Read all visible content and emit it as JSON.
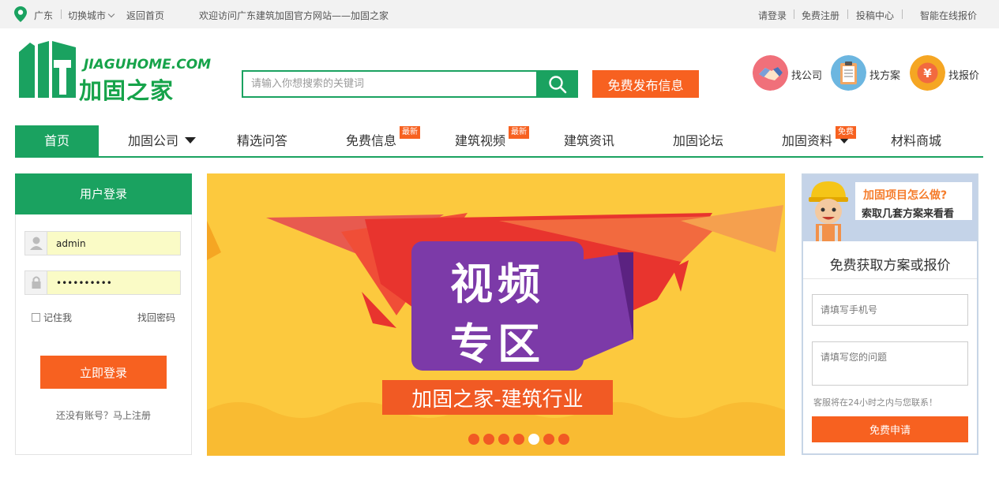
{
  "topbar": {
    "location": "广东",
    "switch_city": "切换城市",
    "back_home": "返回首页",
    "welcome": "欢迎访问广东建筑加固官方网站——加固之家",
    "login": "请登录",
    "register": "免费注册",
    "submit_center": "投稿中心",
    "online_quote": "智能在线报价"
  },
  "logo": {
    "en": "JIAGUHOME.COM",
    "cn": "加固之家",
    "accent_color": "#1aa260"
  },
  "search": {
    "placeholder": "请输入你想搜索的关键词",
    "button_icon": "search-icon",
    "publish_label": "免费发布信息",
    "publish_color": "#f76120"
  },
  "quick_links": [
    {
      "label": "找公司",
      "icon": "handshake-icon",
      "color": "#f0707a"
    },
    {
      "label": "找方案",
      "icon": "clipboard-icon",
      "color": "#6cb6e0"
    },
    {
      "label": "找报价",
      "icon": "yuan-coin-icon",
      "color": "#f5a623"
    }
  ],
  "nav": {
    "items": [
      {
        "label": "首页",
        "active": true
      },
      {
        "label": "加固公司",
        "dropdown": true
      },
      {
        "label": "精选问答"
      },
      {
        "label": "免费信息",
        "badge": "最新"
      },
      {
        "label": "建筑视频",
        "badge": "最新"
      },
      {
        "label": "建筑资讯"
      },
      {
        "label": "加固论坛"
      },
      {
        "label": "加固资料",
        "badge": "免费",
        "dropdown": true
      },
      {
        "label": "材料商城"
      }
    ]
  },
  "login": {
    "title": "用户登录",
    "username": "admin",
    "password": "••••••••••",
    "remember": "记住我",
    "forgot": "找回密码",
    "submit": "立即登录",
    "register_prompt": "还没有账号？马上注册"
  },
  "banner": {
    "line1": "视频",
    "line2": "专区",
    "subtitle": "加固之家-建筑行业",
    "slide_count": 7,
    "active_slide": 5
  },
  "quote": {
    "promo_line1": "加固项目怎么做?",
    "promo_line2": "索取几套方案来看看",
    "heading": "免费获取方案或报价",
    "phone_placeholder": "请填写手机号",
    "question_placeholder": "请填写您的问题",
    "note": "客服将在24小时之内与您联系！",
    "submit": "免费申请"
  }
}
